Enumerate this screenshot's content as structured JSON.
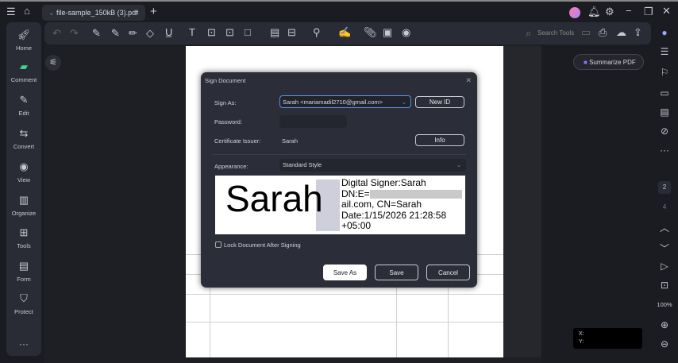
{
  "tab": {
    "title": "file-sample_150kB (3).pdf"
  },
  "sidebar": [
    {
      "label": "Home",
      "icon": "rocket-icon"
    },
    {
      "label": "Comment",
      "icon": "comment-icon"
    },
    {
      "label": "Edit",
      "icon": "edit-icon"
    },
    {
      "label": "Convert",
      "icon": "convert-icon"
    },
    {
      "label": "View",
      "icon": "view-icon"
    },
    {
      "label": "Organize",
      "icon": "organize-icon"
    },
    {
      "label": "Tools",
      "icon": "tools-icon"
    },
    {
      "label": "Form",
      "icon": "form-icon"
    },
    {
      "label": "Protect",
      "icon": "protect-icon"
    }
  ],
  "toolbar": {
    "search_placeholder": "Search Tools",
    "summarize": "Summarize PDF"
  },
  "dialog": {
    "title": "Sign Document",
    "sign_as_label": "Sign As:",
    "sign_as_value": "Sarah <mariamadil2710@gmail.com>",
    "new_id": "New ID",
    "password_label": "Password:",
    "issuer_label": "Certificate Issuer:",
    "issuer_value": "Sarah",
    "info": "Info",
    "appearance_label": "Appearance:",
    "appearance_value": "Standard Style",
    "preview": {
      "name": "Sarah",
      "lines": [
        "Digital Signer:Sarah",
        "DN:E=",
        "ail.com, CN=Sarah",
        "Date:1/15/2026 21:28:58",
        "+05:00"
      ]
    },
    "lock_label": "Lock Document After Signing",
    "save_as": "Save As",
    "save": "Save",
    "cancel": "Cancel"
  },
  "pager": {
    "current": "2",
    "total": "4",
    "zoom": "100%"
  },
  "coords": {
    "x": "X:",
    "y": "Y:"
  }
}
